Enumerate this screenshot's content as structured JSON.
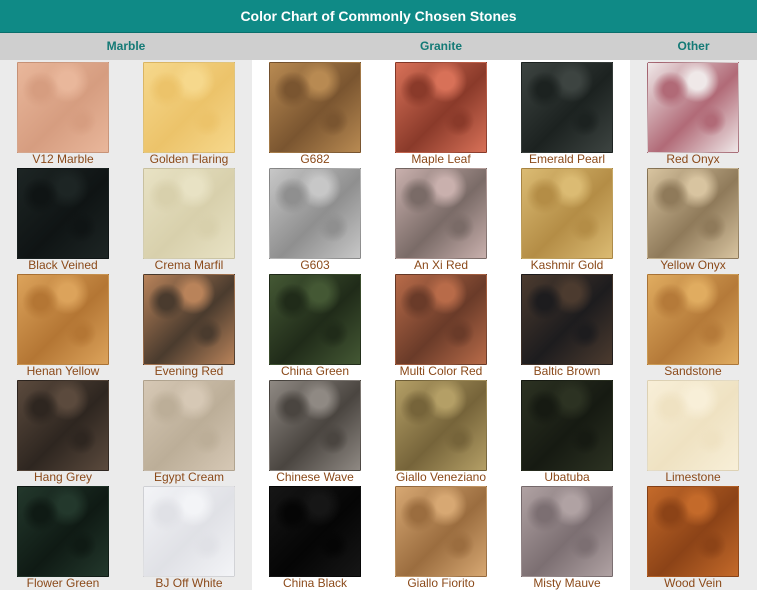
{
  "title": "Color Chart of Commonly Chosen Stones",
  "categories": {
    "marble": "Marble",
    "granite": "Granite",
    "other": "Other"
  },
  "stones": [
    [
      {
        "name": "V12 Marble",
        "colors": [
          "#e9b79b",
          "#d69d80"
        ]
      },
      {
        "name": "Golden Flaring",
        "colors": [
          "#f6d88c",
          "#ecc36a"
        ]
      },
      {
        "name": "G682",
        "colors": [
          "#b88a52",
          "#7a5530"
        ]
      },
      {
        "name": "Maple Leaf",
        "colors": [
          "#d87158",
          "#8a3a2a"
        ]
      },
      {
        "name": "Emerald Pearl",
        "colors": [
          "#3d4441",
          "#1c2220"
        ]
      },
      {
        "name": "Red Onyx",
        "colors": [
          "#efe8e8",
          "#b16a77"
        ]
      }
    ],
    [
      {
        "name": "Black Veined",
        "colors": [
          "#1d2524",
          "#0f1414"
        ]
      },
      {
        "name": "Crema Marfil",
        "colors": [
          "#e8e2c4",
          "#d8d0ac"
        ]
      },
      {
        "name": "G603",
        "colors": [
          "#c7c7c7",
          "#8f8f8f"
        ]
      },
      {
        "name": "An Xi Red",
        "colors": [
          "#c9b0ad",
          "#7a6b67"
        ]
      },
      {
        "name": "Kashmir Gold",
        "colors": [
          "#dbbb73",
          "#b48d46"
        ]
      },
      {
        "name": "Yellow Onyx",
        "colors": [
          "#d8c4a0",
          "#8f7a5a"
        ]
      }
    ],
    [
      {
        "name": "Henan Yellow",
        "colors": [
          "#dca35b",
          "#b47634"
        ]
      },
      {
        "name": "Evening Red",
        "colors": [
          "#b9835a",
          "#4a3b2e"
        ]
      },
      {
        "name": "China Green",
        "colors": [
          "#445834",
          "#202b19"
        ]
      },
      {
        "name": "Multi Color Red",
        "colors": [
          "#b86b49",
          "#6a3b29"
        ]
      },
      {
        "name": "Baltic Brown",
        "colors": [
          "#4c3b2f",
          "#1d1c1e"
        ]
      },
      {
        "name": "Sandstone",
        "colors": [
          "#e0ac60",
          "#b57a39"
        ]
      }
    ],
    [
      {
        "name": "Hang Grey",
        "colors": [
          "#5b4a3d",
          "#2e2620"
        ]
      },
      {
        "name": "Egypt Cream",
        "colors": [
          "#d6c8b5",
          "#bcae98"
        ]
      },
      {
        "name": "Chinese Wave",
        "colors": [
          "#8f8983",
          "#4a4540"
        ]
      },
      {
        "name": "Giallo Veneziano",
        "colors": [
          "#b49f66",
          "#76643a"
        ]
      },
      {
        "name": "Ubatuba",
        "colors": [
          "#2c3222",
          "#161a12"
        ]
      },
      {
        "name": "Limestone",
        "colors": [
          "#f8efd8",
          "#efe2c2"
        ]
      }
    ],
    [
      {
        "name": "Flower Green",
        "colors": [
          "#23382c",
          "#0f1a14"
        ]
      },
      {
        "name": "BJ  Off White",
        "colors": [
          "#f3f4f7",
          "#e0e1e6"
        ]
      },
      {
        "name": "China Black",
        "colors": [
          "#161616",
          "#050505"
        ]
      },
      {
        "name": "Giallo Fiorito",
        "colors": [
          "#d7a873",
          "#9b6d3f"
        ]
      },
      {
        "name": "Misty Mauve",
        "colors": [
          "#b0a2a3",
          "#7c6f72"
        ]
      },
      {
        "name": "Wood Vein",
        "colors": [
          "#c46a2a",
          "#8c4317"
        ]
      }
    ]
  ]
}
